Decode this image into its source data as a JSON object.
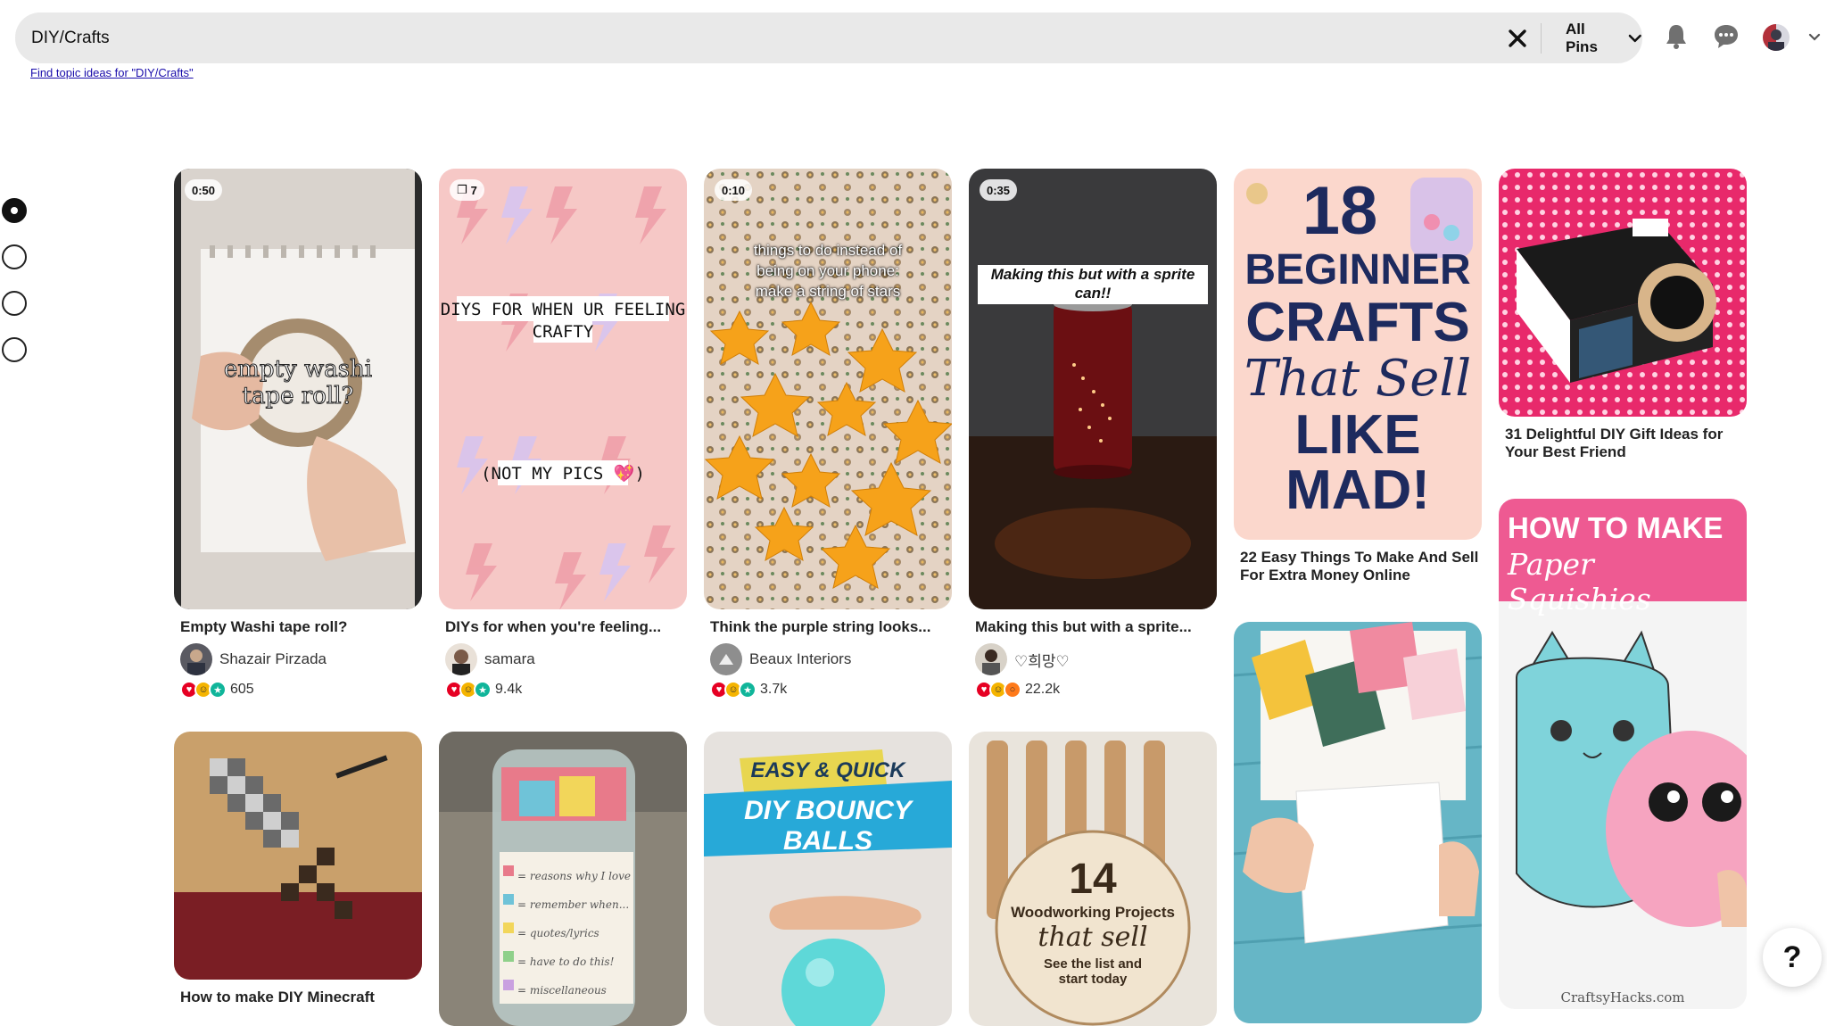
{
  "search": {
    "value": "DIY/Crafts",
    "filter_label": "All Pins",
    "topic_link": "Find topic ideas for \"DIY/Crafts\""
  },
  "icons": {
    "clear": "close-icon",
    "filter_chevron": "chevron-down-icon",
    "notifications": "bell-icon",
    "messages": "chat-bubble-icon",
    "account_chevron": "chevron-down-icon",
    "help": "question-icon"
  },
  "carousel_dots": {
    "count": 4,
    "active_index": 0
  },
  "pins": [
    {
      "title": "Empty Washi tape roll?",
      "badge": "0:50",
      "overlay": [
        "empty washi",
        "tape roll?"
      ],
      "author": "Shazair Pirzada",
      "reaction_count": "605"
    },
    {
      "title": "DIYs for when you're feeling...",
      "badge": "7",
      "overlay": [
        "DIYS FOR WHEN UR FEELING",
        "CRAFTY",
        "(NOT MY PICS 💖)"
      ],
      "author": "samara",
      "reaction_count": "9.4k"
    },
    {
      "title": "Think the purple string looks...",
      "badge": "0:10",
      "overlay": [
        "things to do instead of",
        "being on your phone:",
        "make a string of stars"
      ],
      "author": "Beaux Interiors",
      "reaction_count": "3.7k"
    },
    {
      "title": "Making this but with a sprite...",
      "badge": "0:35",
      "overlay": [
        "Making this but with a sprite",
        "can!!"
      ],
      "author": "♡희망♡",
      "reaction_count": "22.2k"
    },
    {
      "title": "22 Easy Things To Make And Sell For Extra Money Online",
      "overlay": [
        "18",
        "BEGINNER",
        "CRAFTS",
        "That Sell",
        "LIKE MAD!"
      ]
    },
    {
      "title": "31 Delightful DIY Gift Ideas for Your Best Friend"
    },
    {
      "title": "How to make DIY Minecraft"
    },
    {
      "overlay": [
        "= reasons why I love you",
        "= remember when...",
        "= quotes/lyrics",
        "= have to do this!",
        "= miscellaneous"
      ]
    },
    {
      "overlay": [
        "EASY & QUICK",
        "DIY BOUNCY BALLS"
      ]
    },
    {
      "overlay": [
        "14",
        "Woodworking Projects",
        "that sell",
        "See the list and",
        "start today"
      ]
    },
    {
      "overlay": []
    },
    {
      "overlay": [
        "HOW TO MAKE",
        "Paper Squishies",
        "CraftsyHacks.com"
      ]
    }
  ],
  "help_label": "?"
}
